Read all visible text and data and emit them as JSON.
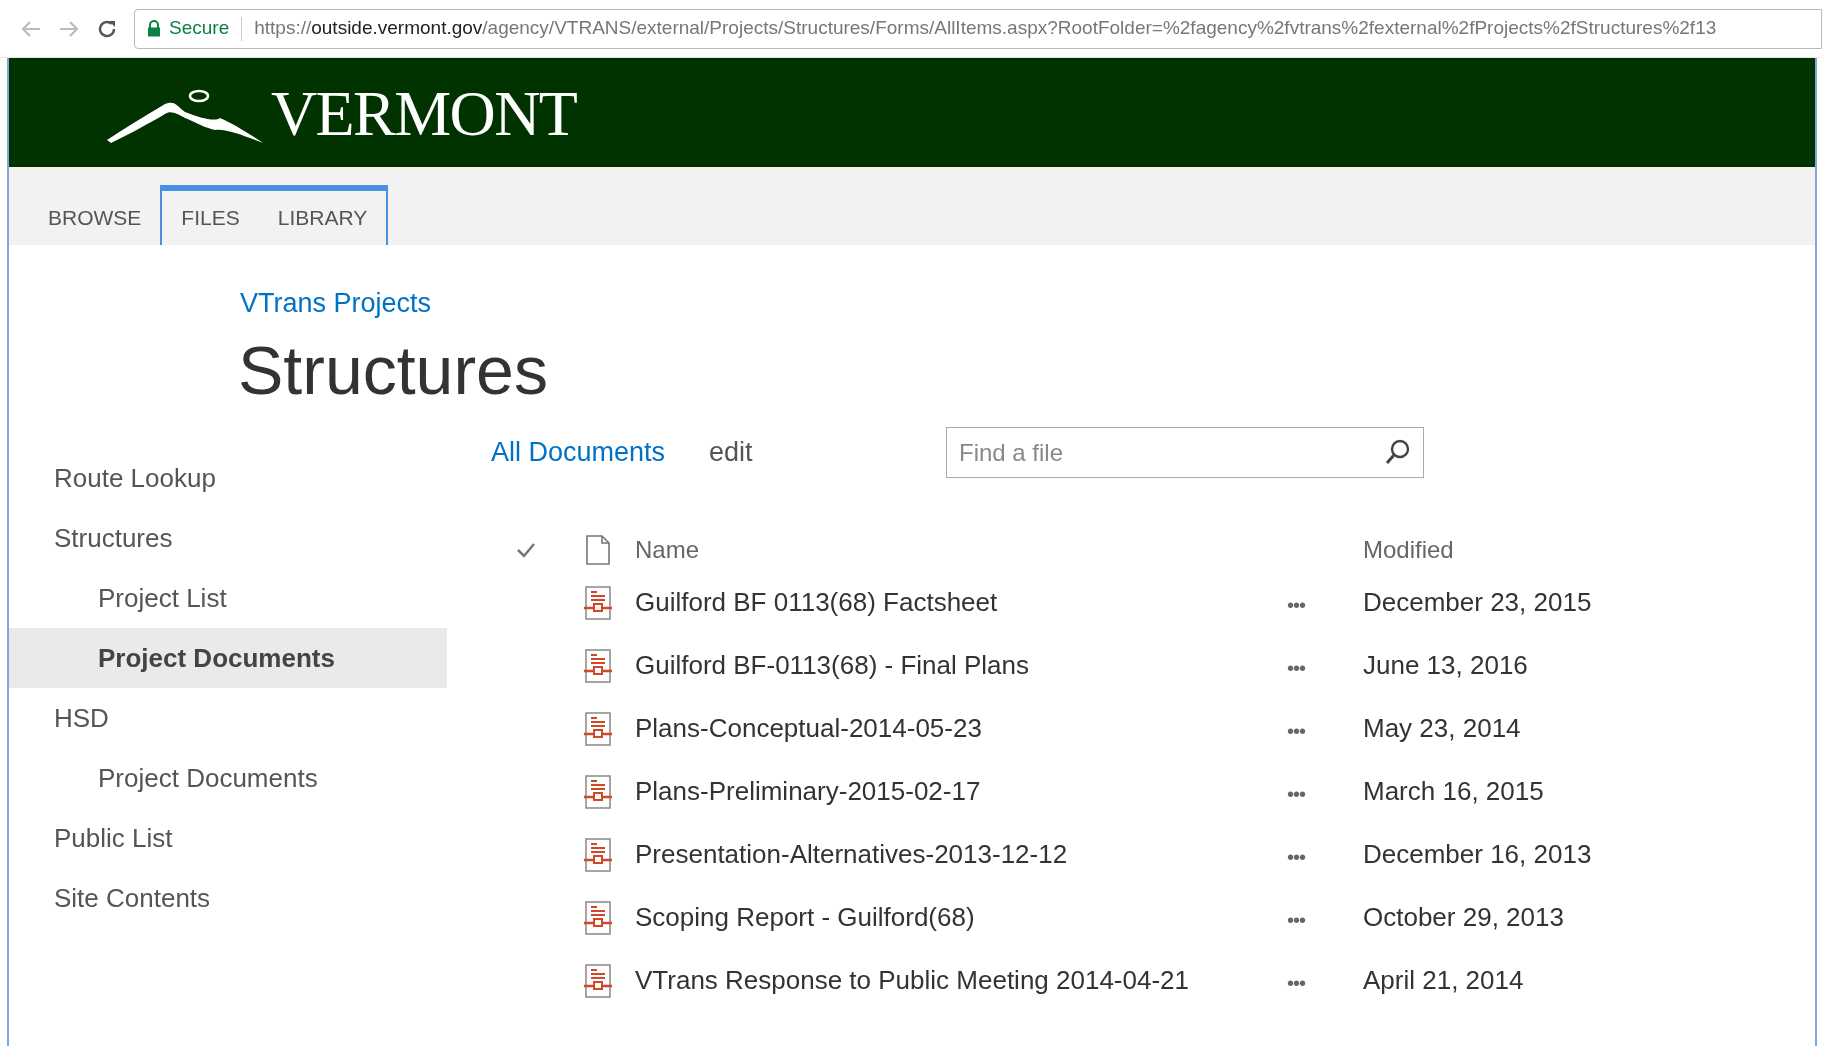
{
  "browser": {
    "secure_label": "Secure",
    "url_scheme": "https://",
    "url_host": "outside.vermont.gov",
    "url_path": "/agency/VTRANS/external/Projects/Structures/Forms/AllItems.aspx?RootFolder=%2fagency%2fvtrans%2fexternal%2fProjects%2fStructures%2f13"
  },
  "header": {
    "logo_text": "VERMONT"
  },
  "ribbon_tabs": [
    {
      "label": "BROWSE",
      "contextual": false
    },
    {
      "label": "FILES",
      "contextual": true
    },
    {
      "label": "LIBRARY",
      "contextual": true
    }
  ],
  "breadcrumb": "VTrans Projects",
  "page_title": "Structures",
  "sidebar": {
    "items": [
      {
        "label": "Route Lookup",
        "selected": false
      },
      {
        "label": "Structures",
        "selected": false,
        "children": [
          {
            "label": "Project List",
            "selected": false
          },
          {
            "label": "Project Documents",
            "selected": true
          }
        ]
      },
      {
        "label": "HSD",
        "selected": false,
        "children": [
          {
            "label": "Project Documents",
            "selected": false
          }
        ]
      },
      {
        "label": "Public List",
        "selected": false
      },
      {
        "label": "Site Contents",
        "selected": false
      }
    ]
  },
  "views": [
    {
      "label": "All Documents",
      "selected": true
    },
    {
      "label": "edit",
      "selected": false
    }
  ],
  "search": {
    "placeholder": "Find a file"
  },
  "table": {
    "columns": [
      "Name",
      "Modified"
    ],
    "rows": [
      {
        "name": "Guilford BF 0113(68) Factsheet",
        "menu": "•••",
        "modified": "December 23, 2015"
      },
      {
        "name": "Guilford BF-0113(68) - Final Plans",
        "menu": "•••",
        "modified": "June 13, 2016"
      },
      {
        "name": "Plans-Conceptual-2014-05-23",
        "menu": "•••",
        "modified": "May 23, 2014"
      },
      {
        "name": "Plans-Preliminary-2015-02-17",
        "menu": "•••",
        "modified": "March 16, 2015"
      },
      {
        "name": "Presentation-Alternatives-2013-12-12",
        "menu": "•••",
        "modified": "December 16, 2013"
      },
      {
        "name": "Scoping Report - Guilford(68)",
        "menu": "•••",
        "modified": "October 29, 2013"
      },
      {
        "name": "VTrans Response to Public Meeting 2014-04-21",
        "menu": "•••",
        "modified": "April 21, 2014"
      }
    ]
  }
}
